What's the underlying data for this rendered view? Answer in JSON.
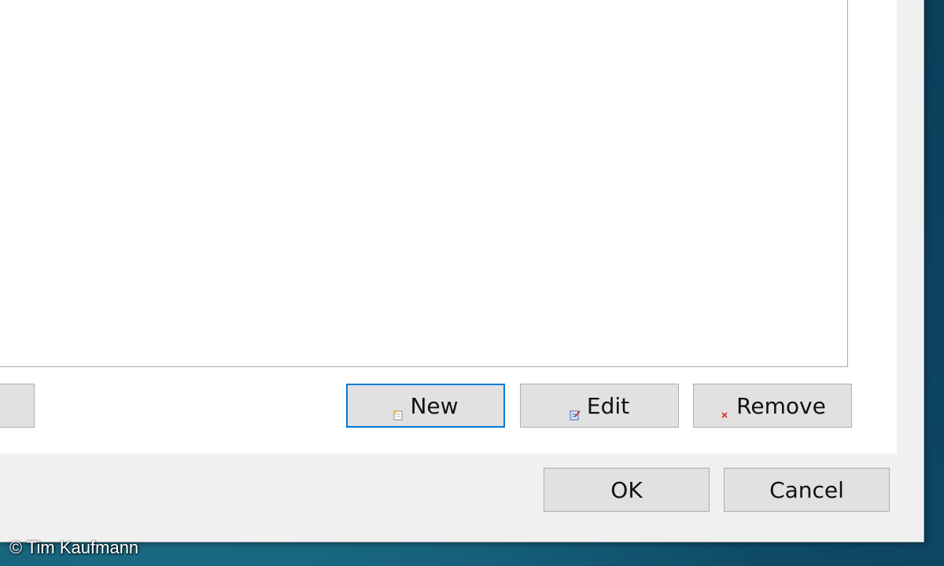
{
  "dialog": {
    "buttons": {
      "new_label": "New",
      "edit_label": "Edit",
      "remove_label": "Remove",
      "ok_label": "OK",
      "cancel_label": "Cancel"
    },
    "icons": {
      "new": "new-document-icon",
      "edit": "edit-document-icon",
      "remove": "remove-x-icon"
    },
    "colors": {
      "default_button_border": "#0078d7",
      "remove_icon": "#d83b2a"
    }
  },
  "watermark": {
    "text": "© Tim Kaufmann"
  }
}
